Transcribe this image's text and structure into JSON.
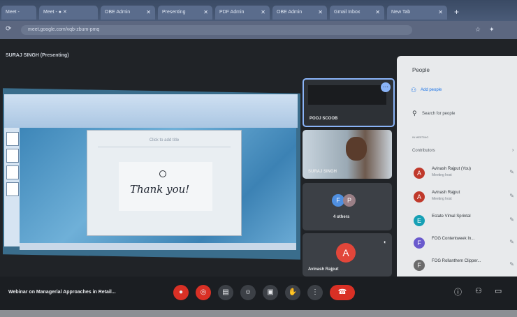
{
  "browser": {
    "tabs": [
      {
        "label": "Meet -"
      },
      {
        "label": "Meet - ● ✕"
      },
      {
        "label": "OBE Admin"
      },
      {
        "label": "Presenting"
      },
      {
        "label": "PDF Admin"
      },
      {
        "label": "OBE Admin"
      },
      {
        "label": "Gmail Inbox"
      },
      {
        "label": "New Tab"
      }
    ],
    "url": "meet.google.com/vqb-zbum-pmq",
    "new_tab_symbol": "+"
  },
  "meeting": {
    "presenter_label": "SURAJ SINGH (Presenting)",
    "title": "Webinar on Managerial Approaches in Retail..."
  },
  "slide": {
    "header_text": "Click to add title",
    "body_text": "Thank you!"
  },
  "tiles": [
    {
      "name": "POOJ SCOOB"
    },
    {
      "name": "SURAJ SINGH"
    },
    {
      "name": "4 others",
      "avatars": [
        "F",
        "P"
      ]
    },
    {
      "name": "Avinash Rajput",
      "avatar": "A"
    }
  ],
  "people_panel": {
    "title": "People",
    "add_people": "Add people",
    "search_placeholder": "Search for people",
    "section_label": "IN MEETING",
    "contributors_label": "Contributors",
    "participants": [
      {
        "avatar": "A",
        "name": "Avinash Rajput (You)",
        "sub": "Meeting host",
        "color": "#c0392b"
      },
      {
        "avatar": "A",
        "name": "Avinash Rajput",
        "sub": "Meeting host",
        "color": "#c0392b"
      },
      {
        "avatar": "E",
        "name": "Estate Vimal Sprintal",
        "sub": "",
        "color": "#16a0b5"
      },
      {
        "avatar": "F",
        "name": "FOG Contentweek In...",
        "sub": "",
        "color": "#6a5acd"
      },
      {
        "avatar": "F",
        "name": "FOG Rollanthem Clipper...",
        "sub": "",
        "color": "#6b6b6b"
      }
    ]
  },
  "colors": {
    "end_call": "#d93025",
    "accent": "#8ab4f8"
  },
  "icons": {
    "mic_off": "mic-off-icon",
    "cam_off": "camera-off-icon",
    "captions": "captions-icon",
    "emoji": "emoji-icon",
    "present": "present-icon",
    "raise_hand": "raise-hand-icon",
    "more": "more-options-icon",
    "end_call": "end-call-icon"
  }
}
